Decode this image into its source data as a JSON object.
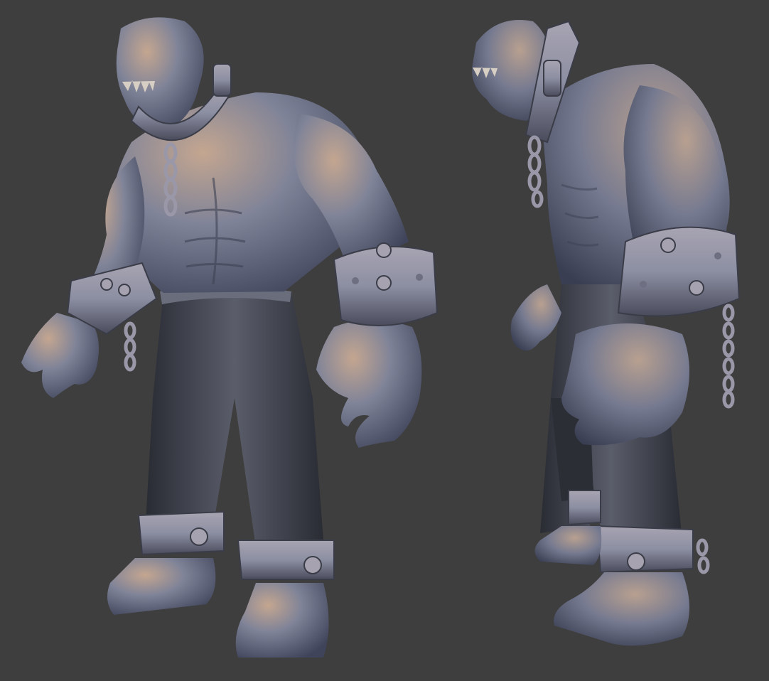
{
  "scene": {
    "background": "#3e3e3e",
    "material": {
      "skin_light": "#c4a690",
      "skin_mid": "#7f8398",
      "skin_dark": "#40445a",
      "cloth_light": "#5a5d6a",
      "cloth_dark": "#2a2c34",
      "metal": "#8c8fa2",
      "metal_dark": "#4a4c5c"
    },
    "views": [
      {
        "name": "three-quarter-front-view"
      },
      {
        "name": "side-view"
      }
    ]
  }
}
